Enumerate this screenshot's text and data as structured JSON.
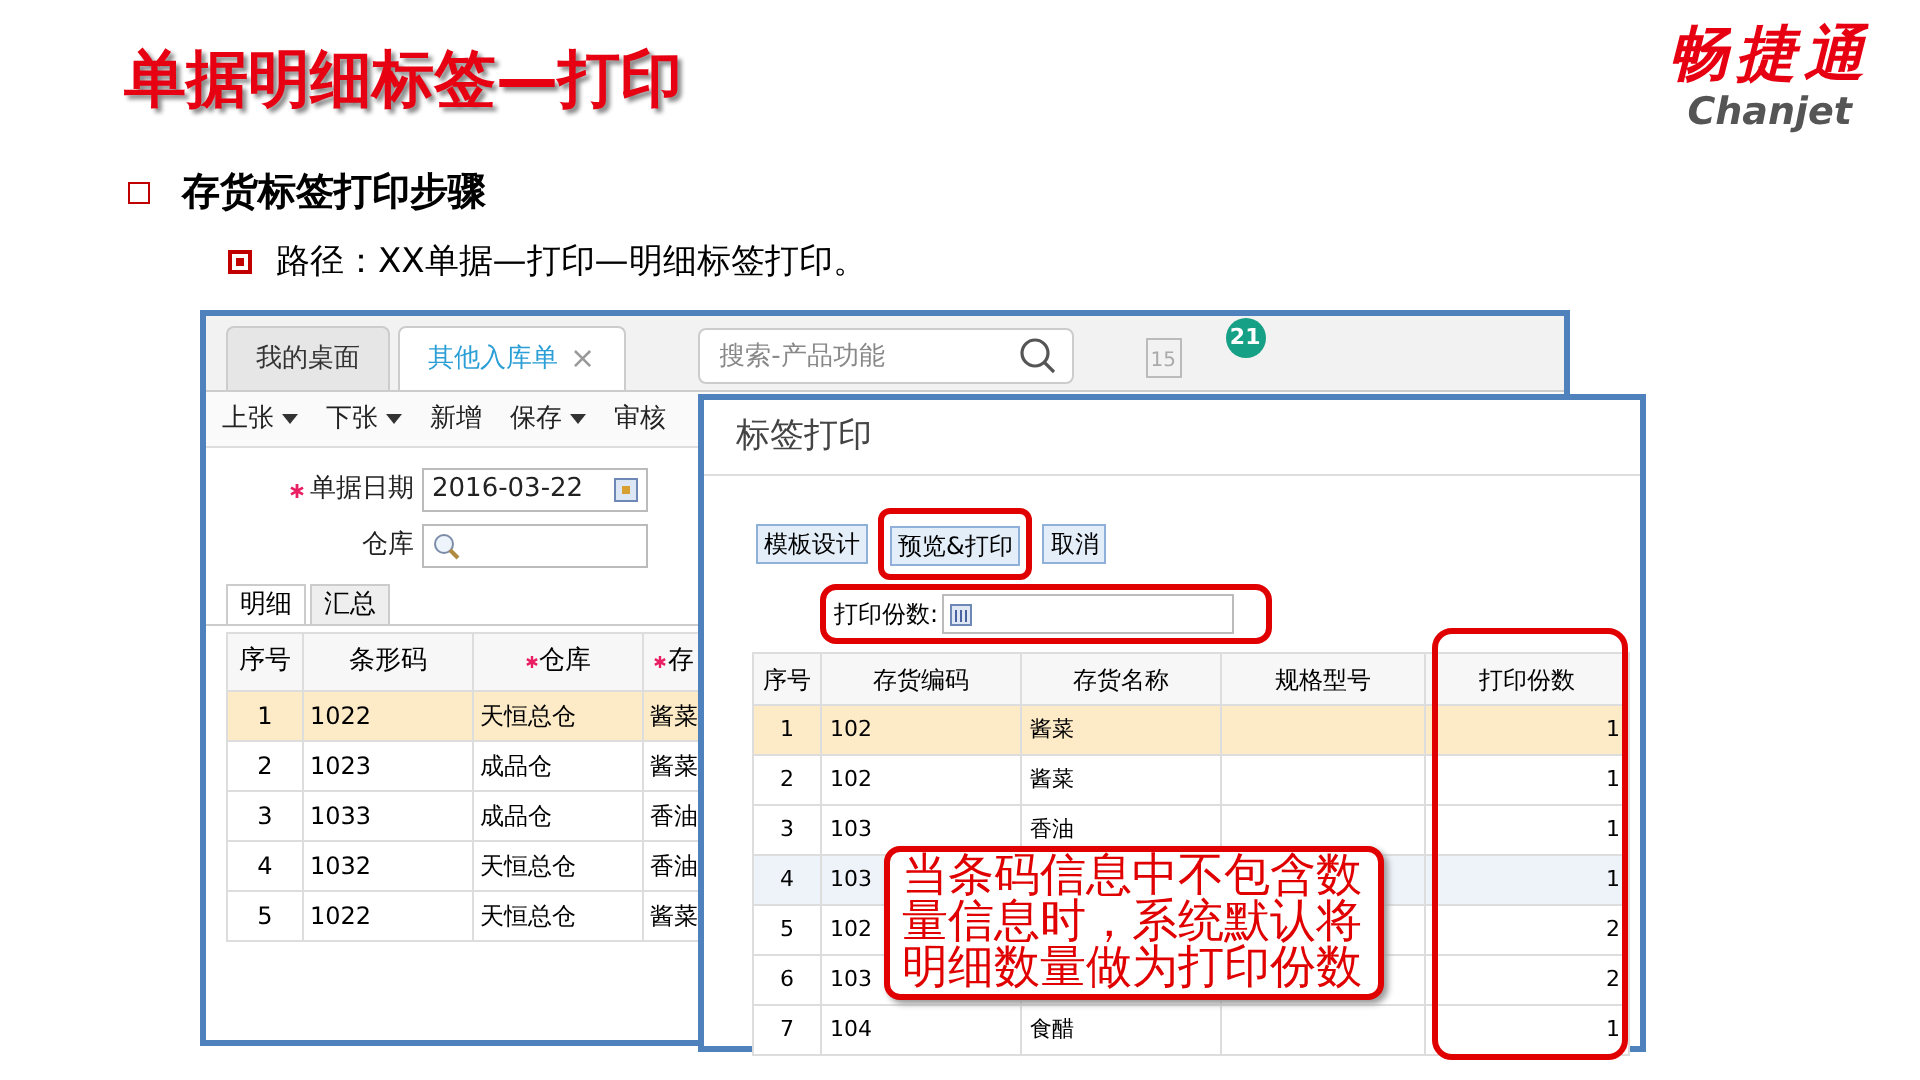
{
  "slide": {
    "title": "单据明细标签—打印",
    "logo": {
      "name_cn": "畅捷通",
      "name_en": "Chanjet"
    },
    "bullets": [
      {
        "text": "存货标签打印步骤",
        "children": [
          {
            "text": "路径：XX单据—打印—明细标签打印。"
          }
        ]
      }
    ]
  },
  "back_window": {
    "tabs": [
      {
        "label": "我的桌面",
        "selected": false,
        "closable": false
      },
      {
        "label": "其他入库单",
        "selected": true,
        "closable": true
      }
    ],
    "close_glyph": "×",
    "search": {
      "placeholder": "搜索-产品功能"
    },
    "calendar_day": "15",
    "badge": "21",
    "toolbar": [
      {
        "label": "上张",
        "dropdown": true
      },
      {
        "label": "下张",
        "dropdown": true
      },
      {
        "label": "新增",
        "dropdown": false
      },
      {
        "label": "保存",
        "dropdown": true
      },
      {
        "label": "审核",
        "dropdown": false
      }
    ],
    "form": [
      {
        "label": "单据日期",
        "required": true,
        "value": "2016-03-22",
        "kind": "date"
      },
      {
        "label": "仓库",
        "required": false,
        "kind": "lookup"
      }
    ],
    "subtabs": [
      {
        "label": "明细",
        "selected": true
      },
      {
        "label": "汇总",
        "selected": false
      }
    ],
    "table": {
      "columns": [
        {
          "label": "序号",
          "required": false
        },
        {
          "label": "条形码",
          "required": false
        },
        {
          "label": "仓库",
          "required": true
        },
        {
          "label": "存",
          "required": true
        }
      ],
      "rows": [
        {
          "cells": [
            "1",
            "1022",
            "天恒总仓",
            "酱菜"
          ],
          "selected": true
        },
        {
          "cells": [
            "2",
            "1023",
            "成品仓",
            "酱菜"
          ],
          "selected": false
        },
        {
          "cells": [
            "3",
            "1033",
            "成品仓",
            "香油"
          ],
          "selected": false
        },
        {
          "cells": [
            "4",
            "1032",
            "天恒总仓",
            "香油"
          ],
          "selected": false
        },
        {
          "cells": [
            "5",
            "1022",
            "天恒总仓",
            "酱菜"
          ],
          "selected": false
        }
      ]
    }
  },
  "dialog": {
    "title": "标签打印",
    "buttons": [
      {
        "label": "模板设计",
        "highlighted": false
      },
      {
        "label": "预览&打印",
        "highlighted": true
      },
      {
        "label": "取消",
        "highlighted": false
      }
    ],
    "copies_field": {
      "label": "打印份数:"
    },
    "table": {
      "columns": [
        "序号",
        "存货编码",
        "存货名称",
        "规格型号",
        "打印份数"
      ],
      "rows": [
        {
          "cells": [
            "1",
            "102",
            "酱菜",
            "",
            "1"
          ],
          "selected": true
        },
        {
          "cells": [
            "2",
            "102",
            "酱菜",
            "",
            "1"
          ],
          "selected": false
        },
        {
          "cells": [
            "3",
            "103",
            "香油",
            "",
            "1"
          ],
          "selected": false
        },
        {
          "cells": [
            "4",
            "103",
            "",
            "",
            "1"
          ],
          "selected": false
        },
        {
          "cells": [
            "5",
            "102",
            "",
            "",
            "2"
          ],
          "selected": false
        },
        {
          "cells": [
            "6",
            "103",
            "",
            "",
            "2"
          ],
          "selected": false
        },
        {
          "cells": [
            "7",
            "104",
            "食醋",
            "",
            "1"
          ],
          "selected": false
        }
      ]
    },
    "callout": "当条码信息中不包含数量信息时，系统默认将明细数量做为打印份数"
  }
}
